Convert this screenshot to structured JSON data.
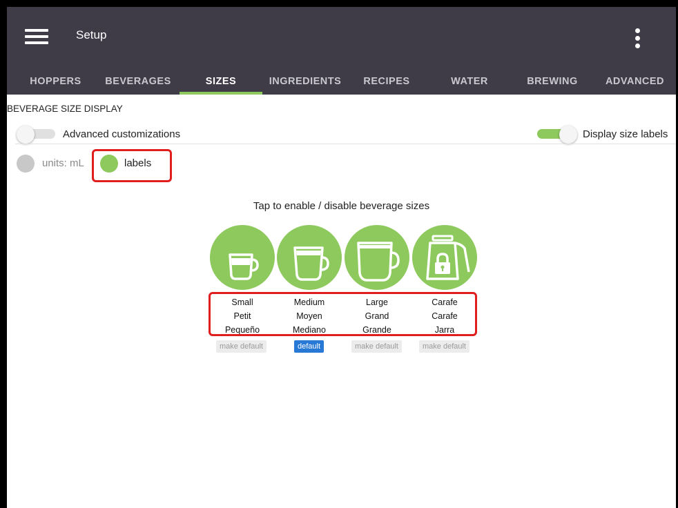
{
  "app": {
    "title": "Setup"
  },
  "tabs": [
    {
      "label": "HOPPERS",
      "active": false
    },
    {
      "label": "BEVERAGES",
      "active": false
    },
    {
      "label": "SIZES",
      "active": true
    },
    {
      "label": "INGREDIENTS",
      "active": false
    },
    {
      "label": "RECIPES",
      "active": false
    },
    {
      "label": "WATER",
      "active": false
    },
    {
      "label": "BREWING",
      "active": false
    },
    {
      "label": "ADVANCED",
      "active": false
    }
  ],
  "section": {
    "header": "BEVERAGE SIZE DISPLAY"
  },
  "toggles": {
    "advanced": {
      "label": "Advanced customizations",
      "on": false
    },
    "display_labels": {
      "label": "Display size labels",
      "on": true
    }
  },
  "display_mode": {
    "units_label": "units: mL",
    "labels_label": "labels",
    "selected": "labels"
  },
  "instruction": "Tap to enable / disable beverage sizes",
  "sizes": [
    {
      "icon": "small-cup-icon",
      "names": [
        "Small",
        "Petit",
        "Pequeño"
      ],
      "button": "make default",
      "is_default": false,
      "locked": false
    },
    {
      "icon": "medium-cup-icon",
      "names": [
        "Medium",
        "Moyen",
        "Mediano"
      ],
      "button": "default",
      "is_default": true,
      "locked": false
    },
    {
      "icon": "large-cup-icon",
      "names": [
        "Large",
        "Grand",
        "Grande"
      ],
      "button": "make default",
      "is_default": false,
      "locked": false
    },
    {
      "icon": "carafe-lock-icon",
      "names": [
        "Carafe",
        "Carafe",
        "Jarra"
      ],
      "button": "make default",
      "is_default": false,
      "locked": true
    }
  ],
  "colors": {
    "appbar": "#3f3c48",
    "accent_green": "#8dc95c",
    "default_blue": "#2878d6",
    "highlight_red": "#e01e1e"
  }
}
